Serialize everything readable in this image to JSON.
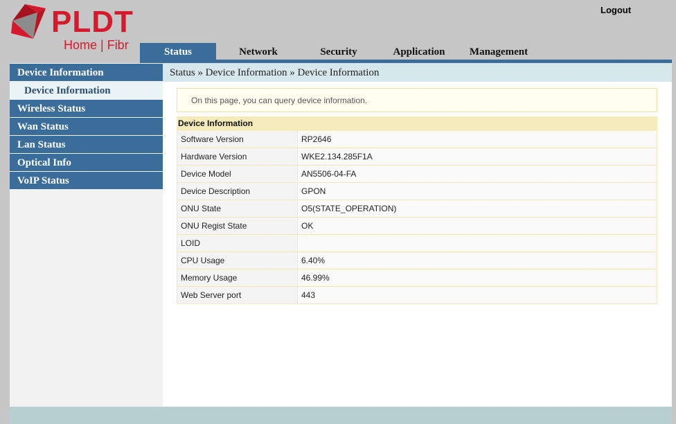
{
  "brand": {
    "name": "PLDT",
    "subtitle": "Home | Fibr",
    "color": "#d7192c"
  },
  "header": {
    "logout_label": "Logout"
  },
  "tabs": [
    {
      "label": "Status",
      "active": true
    },
    {
      "label": "Network",
      "active": false
    },
    {
      "label": "Security",
      "active": false
    },
    {
      "label": "Application",
      "active": false
    },
    {
      "label": "Management",
      "active": false
    }
  ],
  "sidebar": {
    "items": [
      {
        "label": "Device Information",
        "active": true
      },
      {
        "label": "Device Information",
        "sub": true
      },
      {
        "label": "Wireless Status"
      },
      {
        "label": "Wan Status"
      },
      {
        "label": "Lan Status"
      },
      {
        "label": "Optical Info"
      },
      {
        "label": "VoIP Status"
      }
    ]
  },
  "breadcrumb": "Status » Device Information » Device Information",
  "note": "On this page, you can query device information.",
  "table": {
    "title": "Device Information",
    "rows": [
      {
        "key": "Software Version",
        "value": "RP2646"
      },
      {
        "key": "Hardware Version",
        "value": "WKE2.134.285F1A"
      },
      {
        "key": "Device Model",
        "value": "AN5506-04-FA"
      },
      {
        "key": "Device Description",
        "value": "GPON"
      },
      {
        "key": "ONU State",
        "value": "O5(STATE_OPERATION)"
      },
      {
        "key": "ONU Regist State",
        "value": "OK"
      },
      {
        "key": "LOID",
        "value": ""
      },
      {
        "key": "CPU Usage",
        "value": "6.40%"
      },
      {
        "key": "Memory Usage",
        "value": "46.99%"
      },
      {
        "key": "Web Server port",
        "value": "443"
      }
    ]
  },
  "colors": {
    "nav": "#3a6d9a",
    "breadcrumb_bg": "#d6e8ec",
    "table_head": "#f5eab9"
  }
}
